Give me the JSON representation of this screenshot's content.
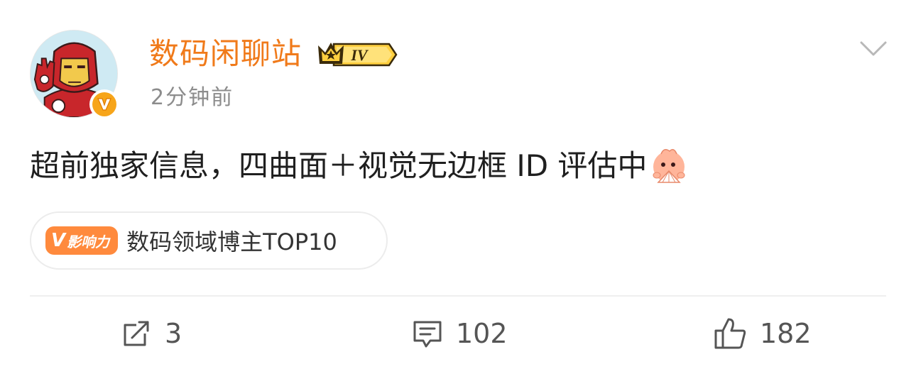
{
  "post": {
    "author": {
      "name": "数码闲聊站",
      "level": "IV",
      "verified": true,
      "avatar_icon": "iron-man-avatar",
      "badge_icon": "orange-v-verified-icon"
    },
    "time": "2分钟前",
    "content": "超前独家信息，四曲面＋视觉无边框 ID 评估中",
    "content_emoji": "fan-peek-emoji",
    "influence": {
      "tag_v": "V",
      "tag_label": "影响力",
      "text": "数码领域博主TOP10"
    },
    "actions": {
      "repost": {
        "icon": "repost-icon",
        "count": "3"
      },
      "comment": {
        "icon": "comment-icon",
        "count": "102"
      },
      "like": {
        "icon": "thumbs-up-icon",
        "count": "182"
      }
    },
    "menu_icon": "chevron-down-icon"
  },
  "colors": {
    "username": "#f07a1a",
    "influence_tag": "#ff8a3d",
    "verified_badge": "#f7a51a",
    "muted_text": "#8c8c8c"
  }
}
